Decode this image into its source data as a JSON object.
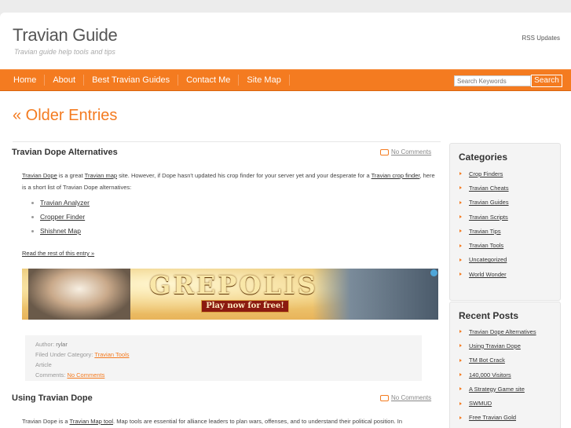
{
  "header": {
    "site_title": "Travian Guide",
    "tagline": "Travian guide help tools and tips",
    "rss_label": "RSS Updates"
  },
  "nav": {
    "items": [
      "Home",
      "About",
      "Best Travian Guides",
      "Contact Me",
      "Site Map"
    ],
    "search_placeholder": "Search Keywords",
    "search_button": "Search"
  },
  "main": {
    "older_entries": "« Older Entries",
    "posts": [
      {
        "title": "Travian Dope Alternatives",
        "comments": "No Comments",
        "intro_1": "Travian Dope",
        "intro_2": " is a great ",
        "intro_3": "Travian map",
        "intro_4": " site. However, if Dope hasn't updated his crop finder for your server yet and your desperate for a ",
        "intro_5": "Travian crop finder",
        "intro_6": ", here is a short list of Travian Dope alternatives:",
        "bullets": [
          "Travian Analyzer",
          "Cropper Finder",
          "Shishnet Map"
        ],
        "read_more": "Read the rest of this entry »",
        "banner_title": "GREPOLIS",
        "banner_cta": "Play now for free!",
        "meta": {
          "author_label": "Author: ",
          "author_name": "rylar",
          "category_label": "Filed Under Category: ",
          "category": "Travian Tools",
          "type": "Article",
          "comments_label": "Comments: ",
          "comments": "No Comments"
        }
      },
      {
        "title": "Using Travian Dope",
        "comments": "No Comments",
        "intro_1": "Travian Dope is a ",
        "intro_2": "Travian Map tool",
        "intro_3": ". Map tools are essential for alliance leaders to plan wars, offenses, and to understand their political position. In"
      }
    ]
  },
  "sidebar": {
    "categories_title": "Categories",
    "categories": [
      "Crop Finders",
      "Travian Cheats",
      "Travian Guides",
      "Travian Scripts",
      "Travian Tips",
      "Travian Tools",
      "Uncategorized",
      "World Wonder"
    ],
    "recent_title": "Recent Posts",
    "recent": [
      "Travian Dope Alternatives",
      "Using Travian Dope",
      "TM Bot Crack",
      "140,000 Visitors",
      "A Strategy Game site",
      "SWMUD",
      "Free Travian Gold"
    ]
  },
  "colors": {
    "accent": "#f47b20",
    "background": "#ececec",
    "page": "#ffffff",
    "meta_box": "#f4f4f4"
  }
}
